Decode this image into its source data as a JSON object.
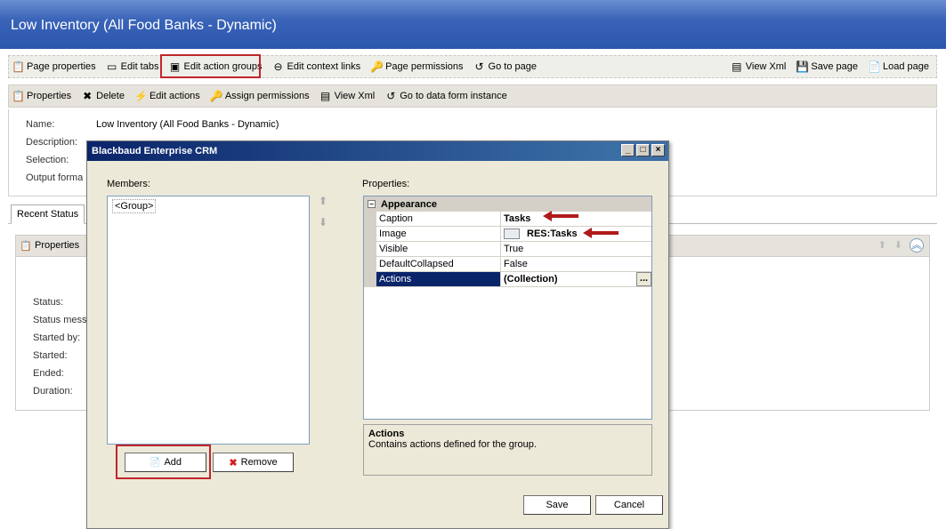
{
  "window": {
    "title": "Low Inventory (All Food Banks - Dynamic)"
  },
  "toolbar1": {
    "left": [
      {
        "name": "page-properties-button",
        "icon": "page-properties-icon",
        "glyph": "📋",
        "label": "Page properties"
      },
      {
        "name": "edit-tabs-button",
        "icon": "tabs-icon",
        "glyph": "▭",
        "label": "Edit tabs"
      },
      {
        "name": "edit-action-groups-button",
        "icon": "action-groups-icon",
        "glyph": "▣",
        "label": "Edit action groups"
      },
      {
        "name": "edit-context-links-button",
        "icon": "link-icon",
        "glyph": "⊖",
        "label": "Edit context links"
      },
      {
        "name": "page-permissions-button",
        "icon": "permissions-icon",
        "glyph": "🔑",
        "label": "Page permissions"
      },
      {
        "name": "go-to-page-button",
        "icon": "go-icon",
        "glyph": "↺",
        "label": "Go to page"
      }
    ],
    "right": [
      {
        "name": "view-xml-button",
        "icon": "xml-icon",
        "glyph": "▤",
        "label": "View Xml"
      },
      {
        "name": "save-page-button",
        "icon": "save-icon",
        "glyph": "💾",
        "label": "Save page"
      },
      {
        "name": "load-page-button",
        "icon": "load-icon",
        "glyph": "📄",
        "label": "Load page"
      }
    ]
  },
  "toolbar2": [
    {
      "name": "properties-button",
      "icon": "properties-icon",
      "glyph": "📋",
      "label": "Properties"
    },
    {
      "name": "delete-button",
      "icon": "delete-icon",
      "glyph": "✖",
      "label": "Delete"
    },
    {
      "name": "edit-actions-button",
      "icon": "lightning-icon",
      "glyph": "⚡",
      "label": "Edit actions"
    },
    {
      "name": "assign-permissions-button",
      "icon": "permissions-icon",
      "glyph": "🔑",
      "label": "Assign permissions"
    },
    {
      "name": "view-xml-form-button",
      "icon": "xml-icon",
      "glyph": "▤",
      "label": "View Xml"
    },
    {
      "name": "go-to-data-form-button",
      "icon": "go-icon",
      "glyph": "↺",
      "label": "Go to data form instance"
    }
  ],
  "page_fields": {
    "name_label": "Name:",
    "name_value": "Low Inventory (All Food Banks - Dynamic)",
    "description_label": "Description:",
    "selection_label": "Selection:",
    "output_label": "Output forma"
  },
  "tabs": {
    "recent_status": "Recent Status"
  },
  "lower_panel": {
    "properties_label": "Properties",
    "fields": [
      "Status:",
      "Status messa",
      "Started by:",
      "Started:",
      "Ended:",
      "Duration:"
    ]
  },
  "dialog": {
    "title": "Blackbaud Enterprise CRM",
    "members_label": "Members:",
    "members": [
      "<Group>"
    ],
    "add_label": "Add",
    "remove_label": "Remove",
    "properties_label": "Properties:",
    "category": "Appearance",
    "properties": [
      {
        "name": "Caption",
        "value": "Tasks",
        "bold": true
      },
      {
        "name": "Image",
        "value": "RES:Tasks",
        "bold": true,
        "image": true
      },
      {
        "name": "Visible",
        "value": "True"
      },
      {
        "name": "DefaultCollapsed",
        "value": "False"
      },
      {
        "name": "Actions",
        "value": "(Collection)",
        "bold": true,
        "selected": true,
        "ellipsis": "..."
      }
    ],
    "help_title": "Actions",
    "help_text": "Contains actions defined for the group.",
    "save_label": "Save",
    "cancel_label": "Cancel"
  },
  "colors": {
    "highlight": "#c0262d",
    "titlebar": "#2c56ad",
    "selection": "#0a246a"
  }
}
